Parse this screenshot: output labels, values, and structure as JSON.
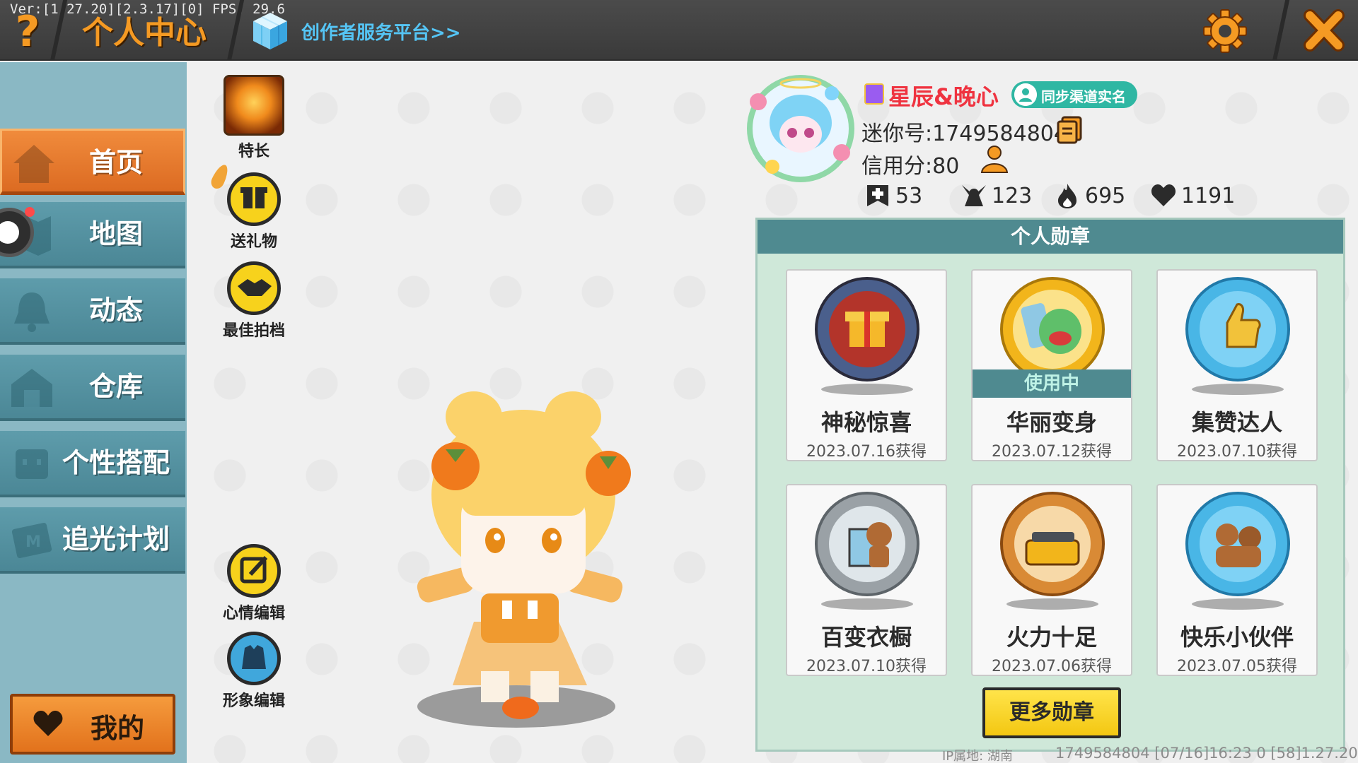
{
  "topbar": {
    "version": "Ver:[1.27.20][2.3.17][0] FPS: 29.6",
    "help_glyph": "?",
    "title": "个人中心",
    "creator_link": "创作者服务平台>>",
    "icons": [
      "help-icon",
      "cube-icon",
      "gear-icon",
      "close-icon"
    ]
  },
  "sidebar": {
    "items": [
      {
        "label": "首页",
        "icon": "house-icon",
        "active": true
      },
      {
        "label": "地图",
        "icon": "map-icon",
        "active": false
      },
      {
        "label": "动态",
        "icon": "bell-icon",
        "active": false
      },
      {
        "label": "仓库",
        "icon": "warehouse-icon",
        "active": false
      },
      {
        "label": "个性搭配",
        "icon": "character-icon",
        "active": false
      },
      {
        "label": "追光计划",
        "icon": "plan-icon",
        "active": false
      }
    ],
    "my_button": "我的"
  },
  "actions": {
    "talent": "特长",
    "gift": "送礼物",
    "partner": "最佳拍档",
    "mood_edit": "心情编辑",
    "image_edit": "形象编辑"
  },
  "profile": {
    "nickname": "星辰&晚心",
    "sync_label": "同步渠道实名",
    "mini_id": "迷你号:1749584804",
    "credit": "信用分:80",
    "stats": [
      {
        "icon": "plus-icon",
        "value": "53"
      },
      {
        "icon": "fans-icon",
        "value": "123"
      },
      {
        "icon": "flame-icon",
        "value": "695"
      },
      {
        "icon": "heart-icon",
        "value": "1191"
      }
    ]
  },
  "medals": {
    "title": "个人勋章",
    "items": [
      {
        "name": "神秘惊喜",
        "date": "2023.07.16获得",
        "in_use": false,
        "color": "#b3342a"
      },
      {
        "name": "华丽变身",
        "date": "2023.07.12获得",
        "in_use": true,
        "in_use_label": "使用中",
        "color": "#f2b51b"
      },
      {
        "name": "集赞达人",
        "date": "2023.07.10获得",
        "in_use": false,
        "color": "#49b6e6"
      },
      {
        "name": "百变衣橱",
        "date": "2023.07.10获得",
        "in_use": false,
        "color": "#9aa1a6"
      },
      {
        "name": "火力十足",
        "date": "2023.07.06获得",
        "in_use": false,
        "color": "#d98a35"
      },
      {
        "name": "快乐小伙伴",
        "date": "2023.07.05获得",
        "in_use": false,
        "color": "#49b6e6"
      }
    ],
    "more_button": "更多勋章"
  },
  "footer": {
    "ip": "IP属地: 湖南",
    "info": "1749584804    [07/16]16:23 0    [58]1.27.20"
  },
  "colors": {
    "accent_orange": "#f59a23",
    "sidebar_teal": "#4b8796",
    "panel_green": "#cfe8d9",
    "nickname_red": "#ef3340"
  }
}
